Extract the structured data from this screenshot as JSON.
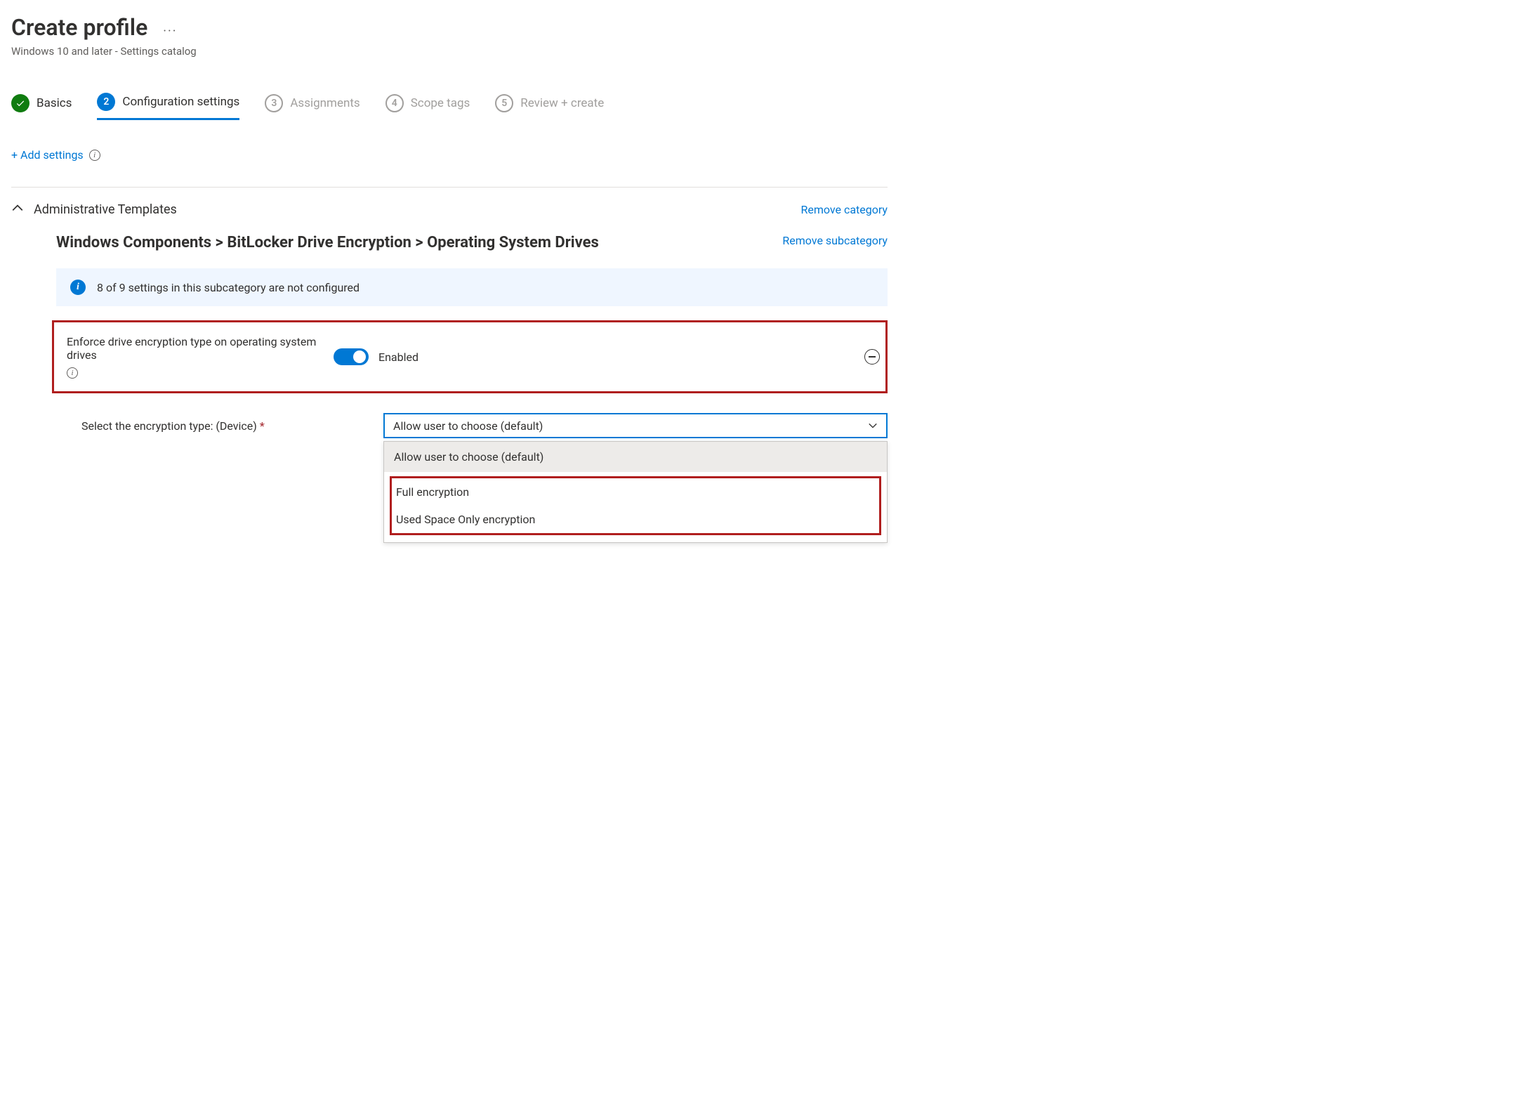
{
  "header": {
    "title": "Create profile",
    "subtitle": "Windows 10 and later - Settings catalog"
  },
  "steps": [
    {
      "num": "",
      "label": "Basics",
      "state": "done"
    },
    {
      "num": "2",
      "label": "Configuration settings",
      "state": "current"
    },
    {
      "num": "3",
      "label": "Assignments",
      "state": "todo"
    },
    {
      "num": "4",
      "label": "Scope tags",
      "state": "todo"
    },
    {
      "num": "5",
      "label": "Review + create",
      "state": "todo"
    }
  ],
  "actions": {
    "add_settings": "+ Add settings"
  },
  "category": {
    "title": "Administrative Templates",
    "remove": "Remove category"
  },
  "subcategory": {
    "title": "Windows Components > BitLocker Drive Encryption > Operating System Drives",
    "remove": "Remove subcategory"
  },
  "banner": {
    "text": "8 of 9 settings in this subcategory are not configured"
  },
  "setting_enforce": {
    "label": "Enforce drive encryption type on operating system drives",
    "toggle_state": "Enabled"
  },
  "select": {
    "label": "Select the encryption type: (Device)",
    "value": "Allow user to choose (default)",
    "options": [
      "Allow user to choose (default)",
      "Full encryption",
      "Used Space Only encryption"
    ]
  }
}
